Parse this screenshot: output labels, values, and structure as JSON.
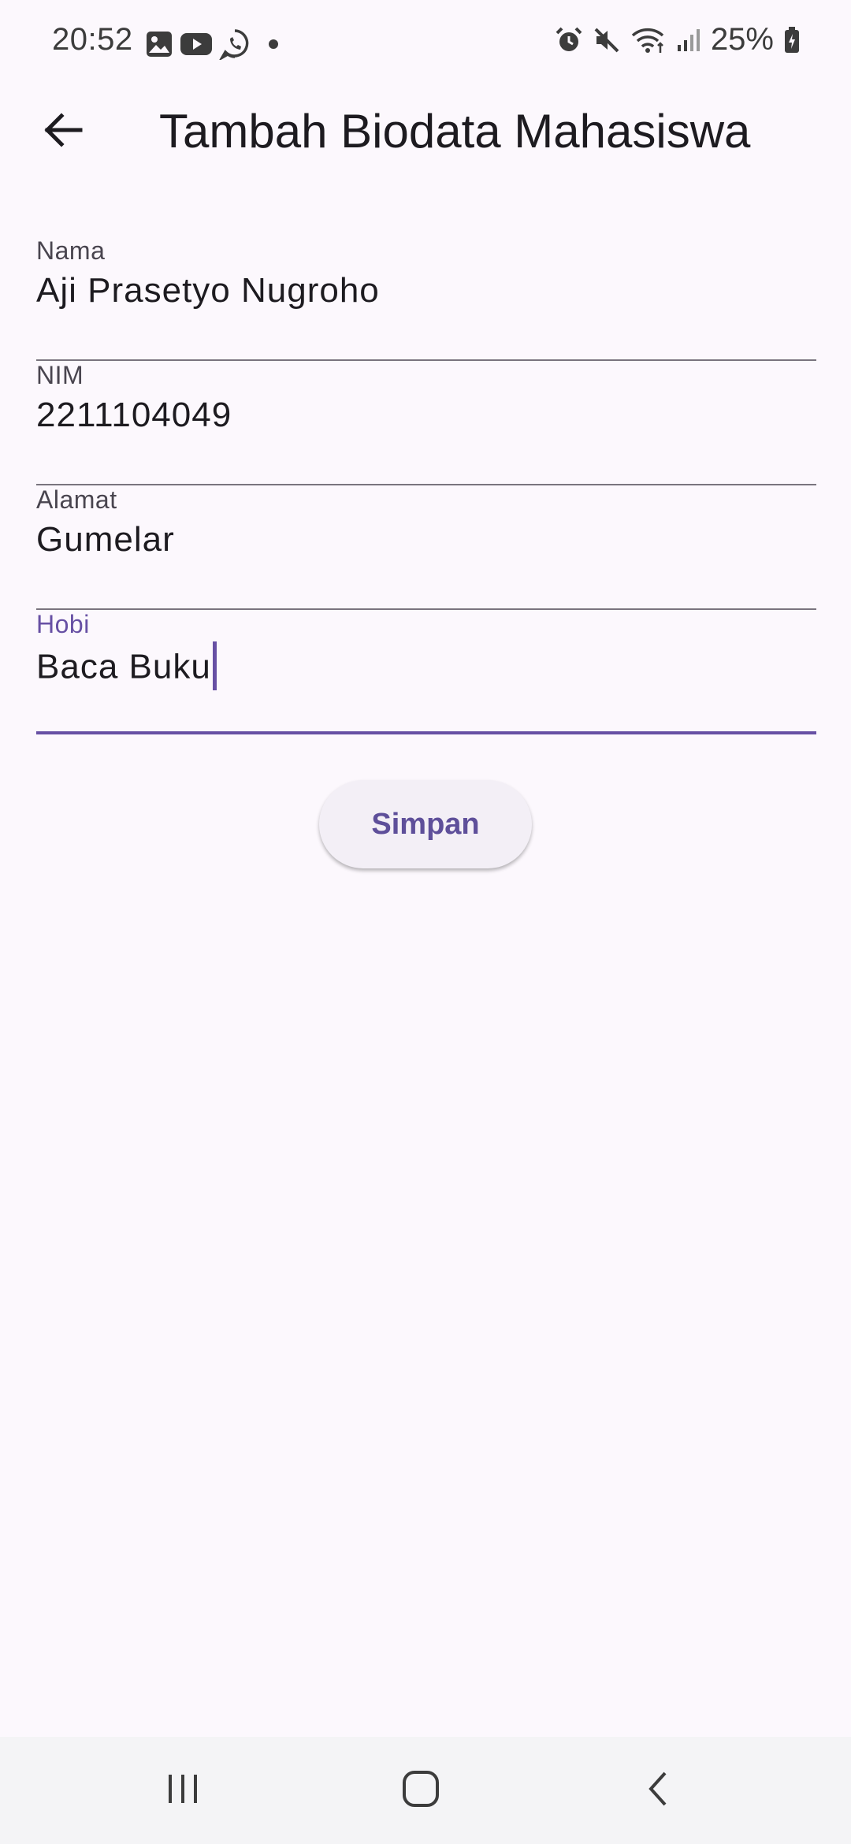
{
  "status_bar": {
    "time": "20:52",
    "left_icons": [
      "gallery-icon",
      "youtube-icon",
      "whatsapp-icon",
      "dot-icon"
    ],
    "right_icons": [
      "alarm-icon",
      "mute-icon",
      "wifi-icon",
      "signal-icon",
      "battery-icon"
    ],
    "battery": "25%"
  },
  "app_bar": {
    "title": "Tambah Biodata Mahasiswa",
    "back_icon": "arrow-back-icon"
  },
  "form": {
    "fields": [
      {
        "label": "Nama",
        "value": "Aji Prasetyo Nugroho",
        "focused": false
      },
      {
        "label": "NIM",
        "value": "2211104049",
        "focused": false
      },
      {
        "label": "Alamat",
        "value": "Gumelar",
        "focused": false
      },
      {
        "label": "Hobi",
        "value": "Baca Buku",
        "focused": true
      }
    ],
    "submit_label": "Simpan"
  },
  "nav_bar": {
    "items": [
      "recents-icon",
      "home-icon",
      "back-icon"
    ]
  },
  "colors": {
    "background": "#fcf8fd",
    "accent": "#6750a4",
    "button_bg": "#f3eff6",
    "button_text": "#5e4f9a",
    "nav_bg": "#f4f4f6"
  }
}
